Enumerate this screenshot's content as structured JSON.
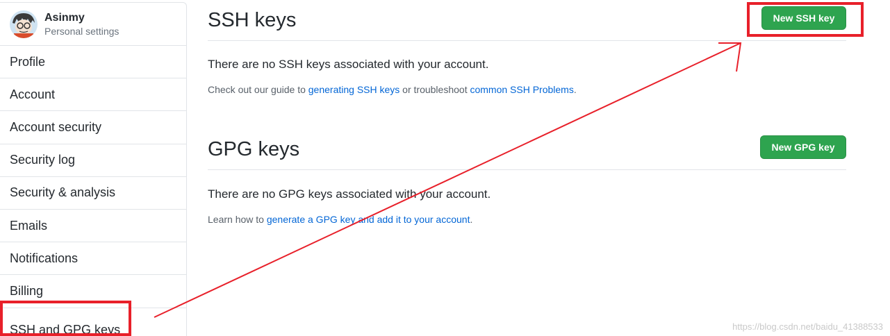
{
  "user": {
    "name": "Asinmy",
    "subtitle": "Personal settings"
  },
  "sidebar": {
    "items": [
      {
        "label": "Profile"
      },
      {
        "label": "Account"
      },
      {
        "label": "Account security"
      },
      {
        "label": "Security log"
      },
      {
        "label": "Security & analysis"
      },
      {
        "label": "Emails"
      },
      {
        "label": "Notifications"
      },
      {
        "label": "Billing"
      },
      {
        "label": "SSH and GPG keys"
      }
    ]
  },
  "ssh": {
    "title": "SSH keys",
    "button": "New SSH key",
    "empty": "There are no SSH keys associated with your account.",
    "help_prefix": "Check out our guide to ",
    "help_link1": "generating SSH keys",
    "help_middle": " or troubleshoot ",
    "help_link2": "common SSH Problems",
    "help_suffix": "."
  },
  "gpg": {
    "title": "GPG keys",
    "button": "New GPG key",
    "empty": "There are no GPG keys associated with your account.",
    "help_prefix": "Learn how to ",
    "help_link": "generate a GPG key and add it to your account",
    "help_suffix": "."
  },
  "watermark": "https://blog.csdn.net/baidu_41388533",
  "colors": {
    "primary_button": "#2ea44f",
    "link": "#0366d6",
    "annotation": "#e8202a"
  }
}
